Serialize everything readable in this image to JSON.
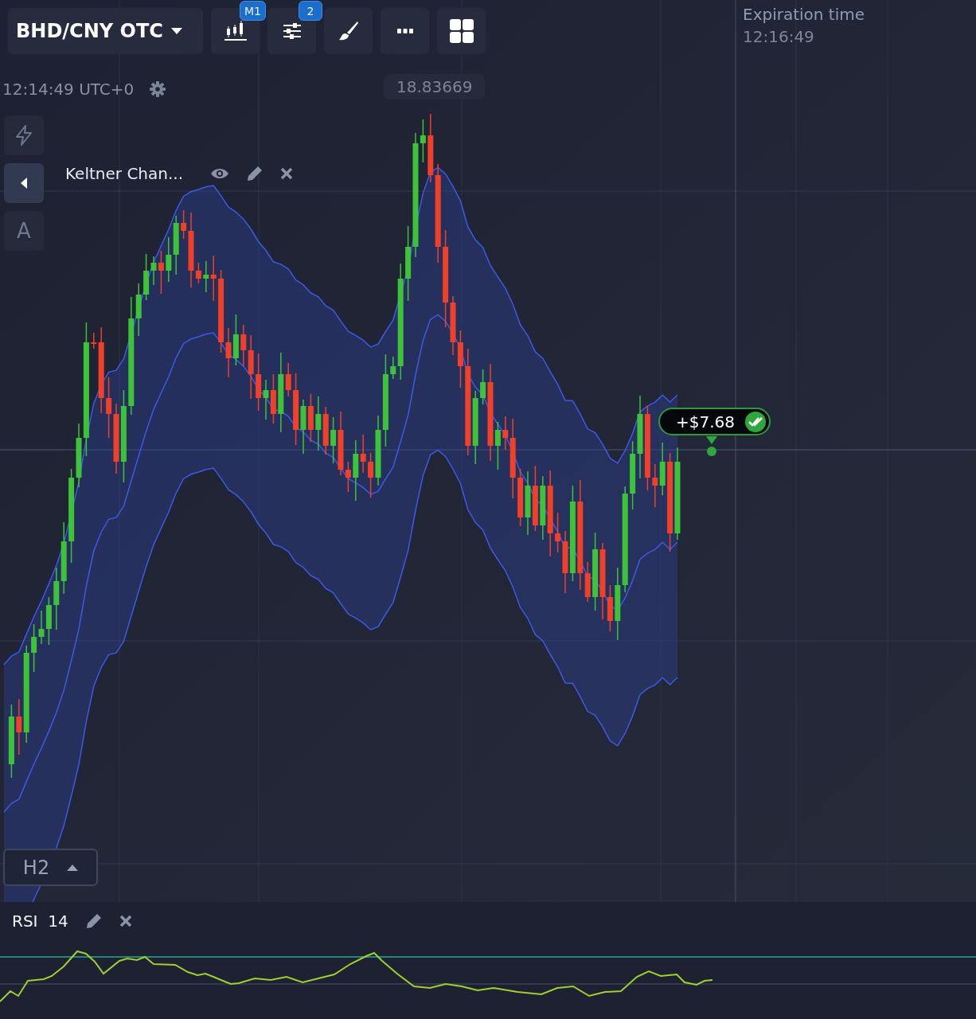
{
  "toolbar": {
    "symbol": "BHD/CNY OTC",
    "buttons": [
      {
        "kind": "candles",
        "badge": "M1"
      },
      {
        "kind": "sliders",
        "badge": "2"
      },
      {
        "kind": "brush"
      },
      {
        "kind": "more"
      },
      {
        "kind": "grid"
      }
    ]
  },
  "clock": {
    "time": "12:14:49 UTC+0"
  },
  "price_label": "18.83669",
  "side_tools": [
    {
      "kind": "lightning",
      "selected": false
    },
    {
      "kind": "collapse",
      "selected": true
    },
    {
      "kind": "text",
      "label": "A",
      "selected": false
    }
  ],
  "indicator": {
    "name": "Keltner Chan..."
  },
  "expiration": {
    "label": "Expiration time",
    "time": "12:16:49"
  },
  "trade": {
    "profit": "+$7.68"
  },
  "timeframe": {
    "label": "H2"
  },
  "rsi": {
    "name": "RSI",
    "period": "14"
  }
}
